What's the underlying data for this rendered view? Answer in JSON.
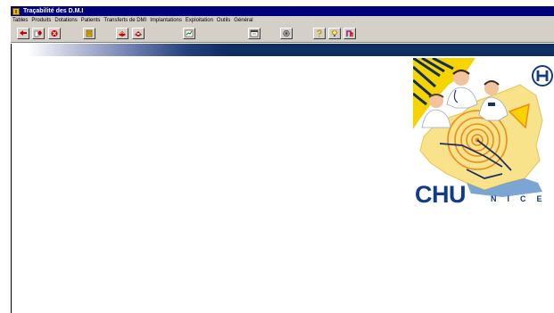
{
  "window": {
    "title": "Traçabilité des D.M.I"
  },
  "menu": {
    "items": [
      "Tables",
      "Produits",
      "Dotations",
      "Patients",
      "Transferts de DMI",
      "Implantations",
      "Exploitation",
      "Outils",
      "Général"
    ]
  },
  "toolbar": {
    "buttons": [
      {
        "icon": "add-record-icon",
        "color": "#c00000"
      },
      {
        "icon": "edit-record-icon",
        "color": "#c00000"
      },
      {
        "icon": "delete-record-icon",
        "color": "#c00000"
      },
      {
        "icon": "document-icon",
        "color": "#806000"
      },
      {
        "icon": "print-icon",
        "color": "#c00000"
      },
      {
        "icon": "print-preview-icon",
        "color": "#c00000"
      },
      {
        "icon": "chart-icon",
        "color": "#008000"
      },
      {
        "icon": "window-icon",
        "color": "#404040"
      },
      {
        "icon": "settings-icon",
        "color": "#404040"
      },
      {
        "icon": "help-icon",
        "color": "#c0a000"
      },
      {
        "icon": "bulb-icon",
        "color": "#c0a000"
      },
      {
        "icon": "exit-icon",
        "color": "#800080"
      }
    ]
  },
  "logo": {
    "brand": "CHU",
    "city": "NICE",
    "brand_color": "#123c88"
  }
}
